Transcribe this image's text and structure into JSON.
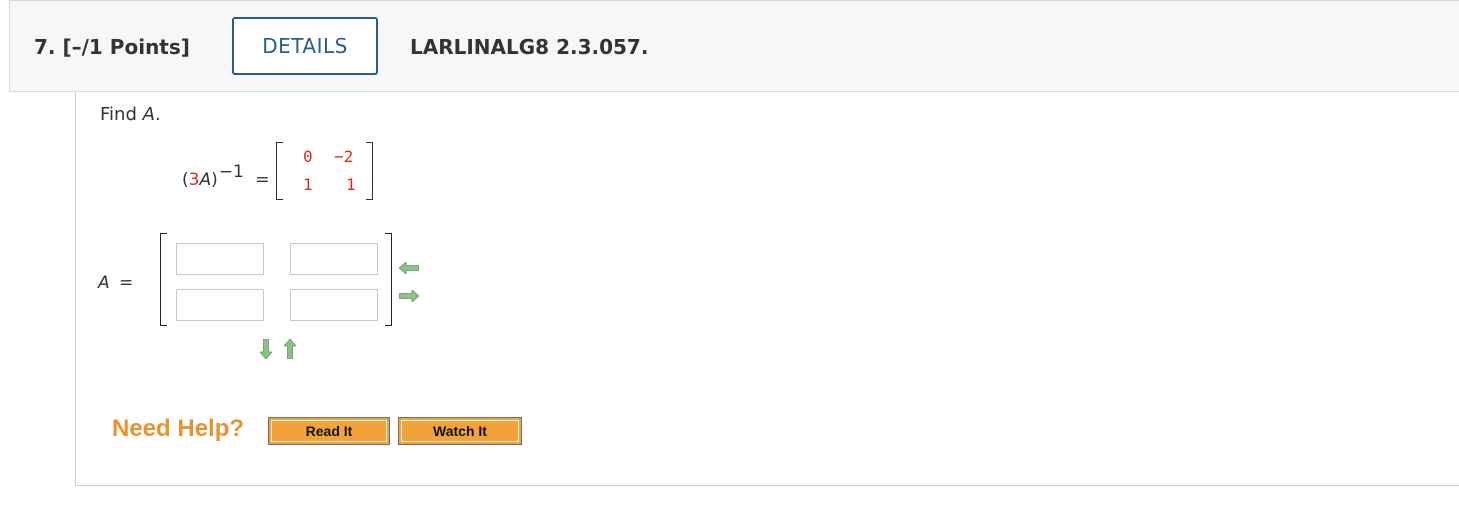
{
  "header": {
    "question_number": "7.",
    "points": "[–/1 Points]",
    "details_label": "DETAILS",
    "reference": "LARLINALG8 2.3.057."
  },
  "question": {
    "prompt_prefix": "Find",
    "prompt_var": "A",
    "prompt_suffix": ".",
    "given": {
      "lhs_open": "(",
      "lhs_coef": "3",
      "lhs_var": "A",
      "lhs_close": ")",
      "exponent": "−1",
      "equals": "=",
      "matrix": [
        [
          "0",
          "−2"
        ],
        [
          "1",
          "1"
        ]
      ]
    },
    "answer": {
      "label_var": "A",
      "equals": "=",
      "inputs": [
        [
          "",
          ""
        ],
        [
          "",
          ""
        ]
      ]
    }
  },
  "help": {
    "need_help": "Need Help?",
    "read_it": "Read It",
    "watch_it": "Watch It"
  },
  "icons": {
    "remove_column": "arrow-left-icon",
    "add_column": "arrow-right-icon",
    "add_row": "arrow-down-icon",
    "remove_row": "arrow-up-icon"
  },
  "colors": {
    "details_border": "#2a5d8f",
    "random_value": "#e0281b",
    "need_help": "#e8932e",
    "help_button": "#f2a23a",
    "arrow": "#8fc08a"
  }
}
